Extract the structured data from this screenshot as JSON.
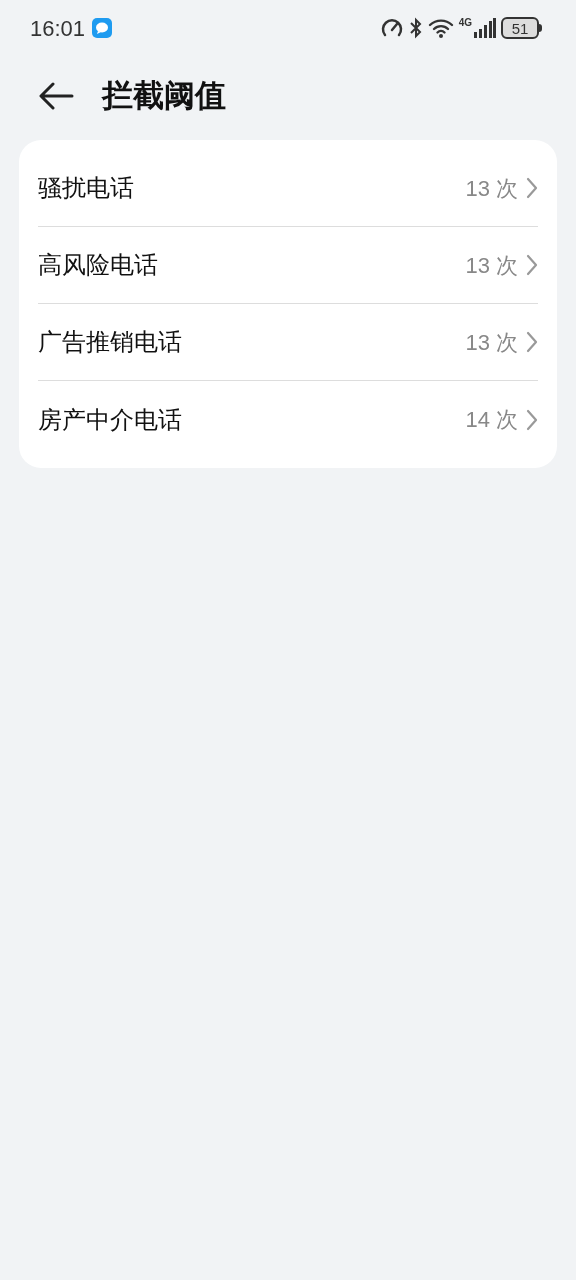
{
  "status_bar": {
    "time": "16:01",
    "network": "4G",
    "battery": "51"
  },
  "header": {
    "title": "拦截阈值"
  },
  "items": [
    {
      "label": "骚扰电话",
      "value": "13 次"
    },
    {
      "label": "高风险电话",
      "value": "13 次"
    },
    {
      "label": "广告推销电话",
      "value": "13 次"
    },
    {
      "label": "房产中介电话",
      "value": "14 次"
    }
  ]
}
